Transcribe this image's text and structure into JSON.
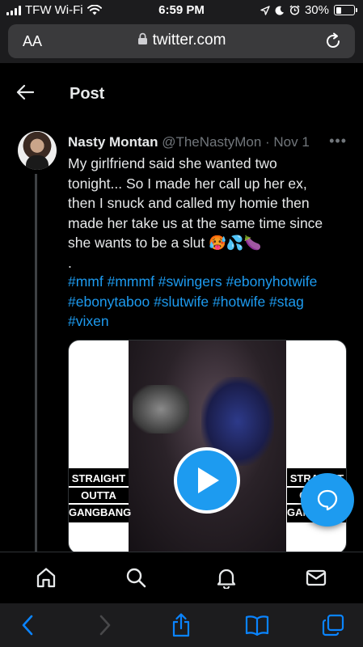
{
  "status_bar": {
    "carrier": "TFW Wi-Fi",
    "time": "6:59 PM",
    "battery_percent": "30%",
    "battery_level": 0.3
  },
  "browser": {
    "text_size_button": "AA",
    "url": "twitter.com"
  },
  "header": {
    "title": "Post"
  },
  "tweet": {
    "display_name": "Nasty Montan",
    "handle": "@TheNastyMon",
    "separator": " · ",
    "date": "Nov 1",
    "text_lines": [
      "My girlfriend said she wanted two",
      "tonight... So I made her call up her ex,",
      "then I snuck and called my homie then",
      "made her take us at the same time since",
      "she wants to be a slut 🥵💦🍆",
      "."
    ],
    "hashtag_lines": [
      "#mmf #mmmf #swingers #ebonyhotwife",
      "#ebonytaboo #slutwife #hotwife #stag",
      "#vixen"
    ],
    "media": {
      "label_left": [
        "STRAIGHT",
        "OUTTA",
        "GANGBANG"
      ],
      "label_right": [
        "STRAIGHT",
        "OUTTA",
        "GANGBANG"
      ]
    }
  },
  "colors": {
    "accent": "#1d9bf0",
    "text": "#e7e9ea",
    "muted": "#71767b",
    "background": "#000000"
  },
  "icons": {
    "tab_bar": [
      "home-icon",
      "search-icon",
      "bell-icon",
      "mail-icon"
    ],
    "safari": [
      "back-icon",
      "forward-icon",
      "share-icon",
      "bookmarks-icon",
      "tabs-icon"
    ]
  }
}
